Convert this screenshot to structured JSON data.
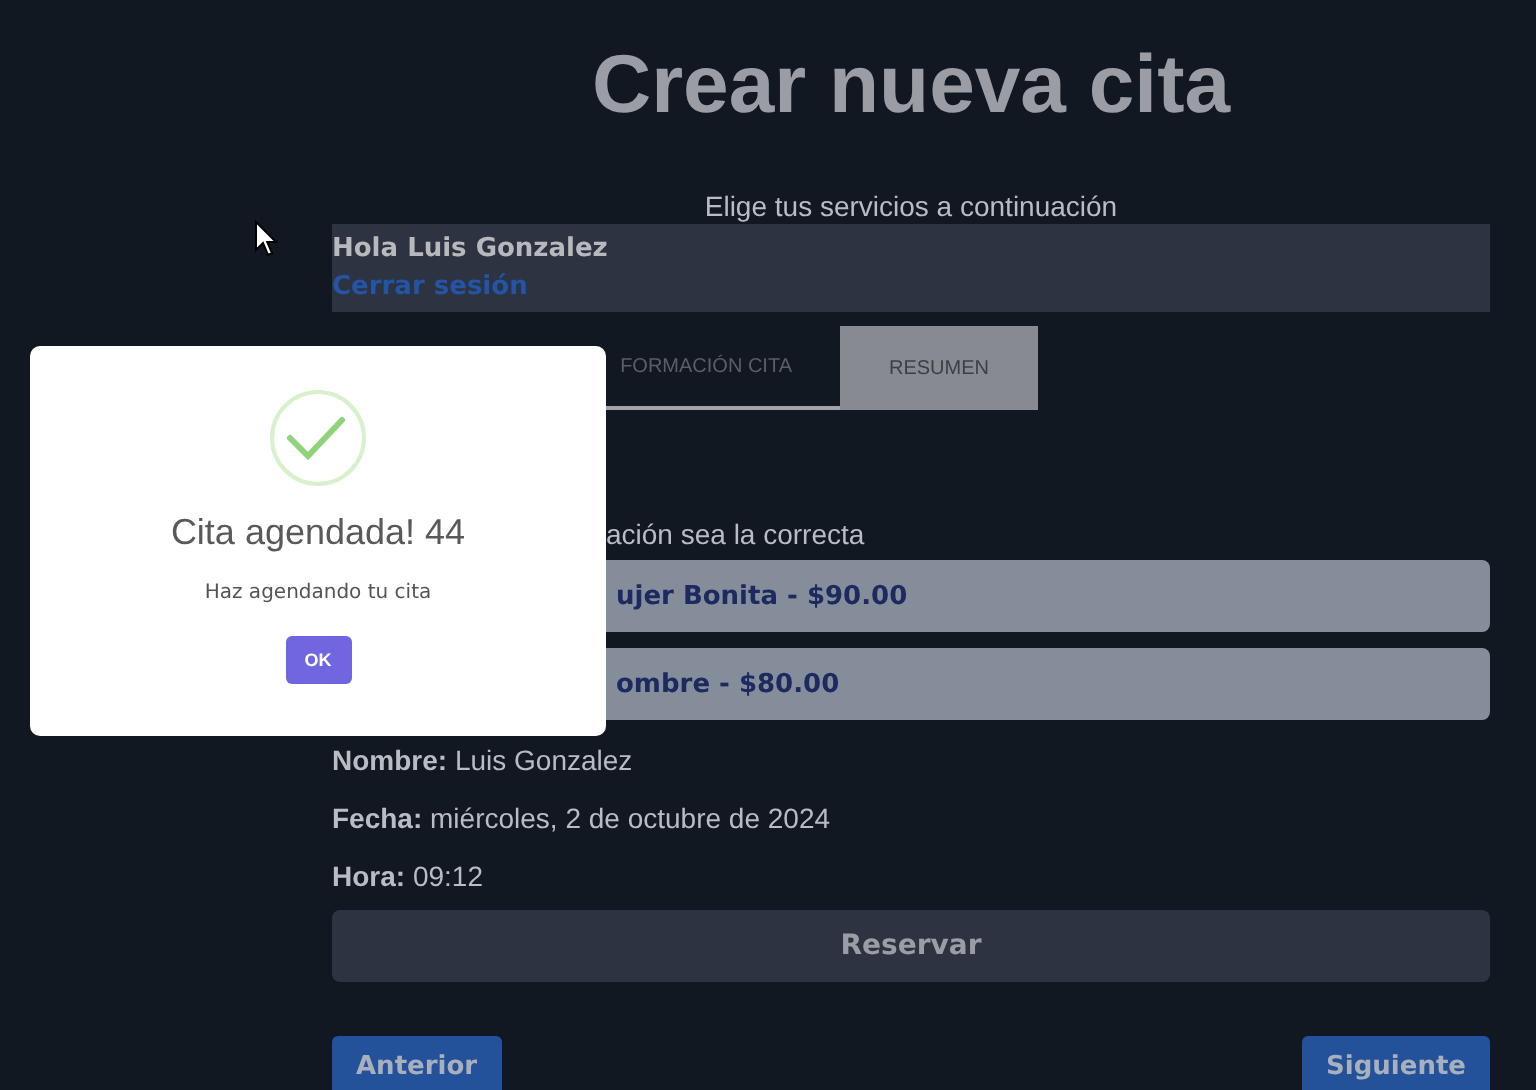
{
  "title": "Crear nueva cita",
  "subtitle": "Elige tus servicios a continuación",
  "header": {
    "greeting": "Hola Luis Gonzalez",
    "logout": "Cerrar sesión"
  },
  "tabs": [
    {
      "label": "FORMACIÓN CITA",
      "selected": false
    },
    {
      "label": "RESUMEN",
      "selected": true
    }
  ],
  "summary": {
    "intro": "ación sea la correcta",
    "services": [
      "ujer Bonita - $90.00",
      "ombre - $80.00"
    ],
    "details": [
      {
        "label": "Nombre:",
        "value": "Luis Gonzalez"
      },
      {
        "label": "Fecha:",
        "value": "miércoles, 2 de octubre de 2024"
      },
      {
        "label": "Hora:",
        "value": "09:12"
      }
    ],
    "reserve": "Reservar"
  },
  "nav": {
    "previous": "Anterior",
    "next": "Siguiente"
  },
  "modal": {
    "title": "Cita agendada! 44",
    "message": "Haz agendando tu cita",
    "ok": "OK"
  }
}
